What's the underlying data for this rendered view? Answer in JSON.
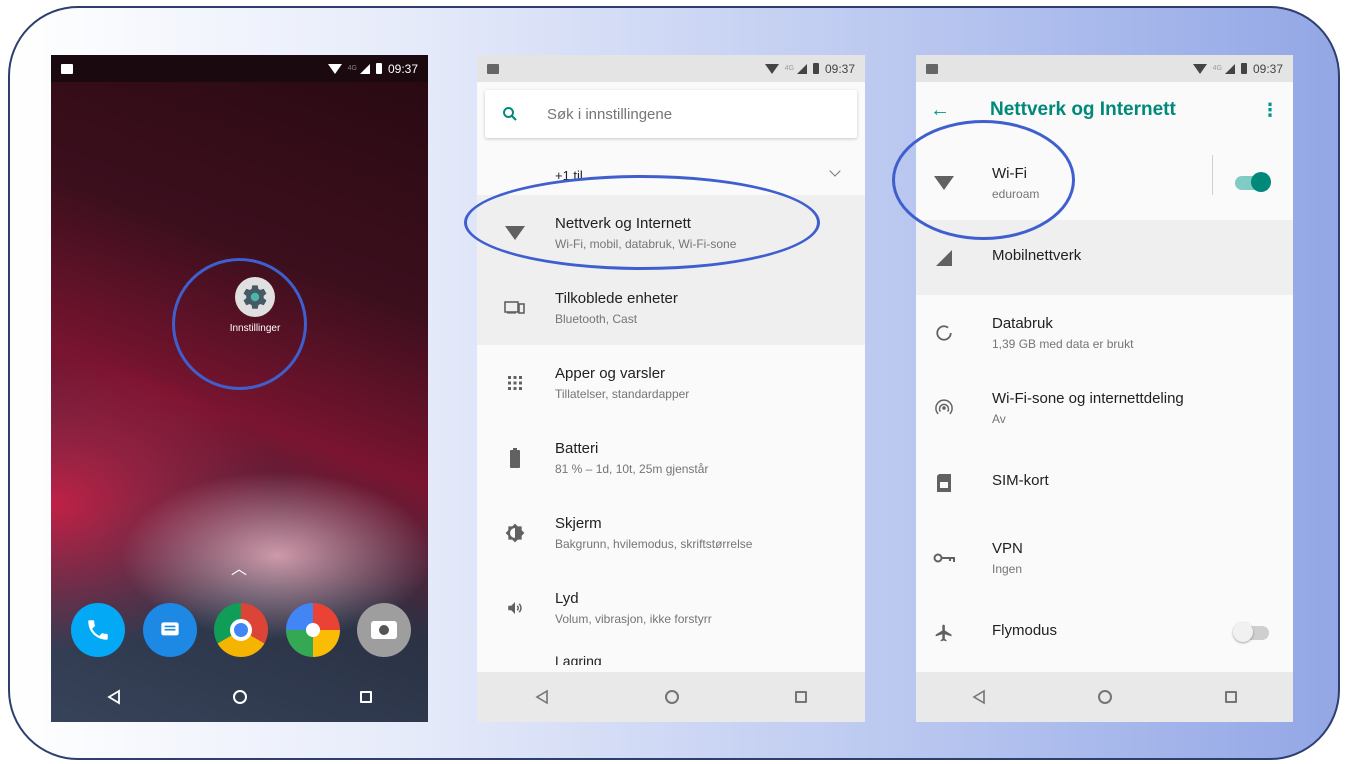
{
  "phone1": {
    "status": {
      "time": "09:37",
      "network": "4G"
    },
    "app_label": "Innstillinger",
    "dock": [
      "phone-icon",
      "messages-icon",
      "chrome-icon",
      "photos-icon",
      "camera-icon"
    ]
  },
  "phone2": {
    "status": {
      "time": "09:37",
      "network": "4G"
    },
    "search_placeholder": "Søk i innstillingene",
    "more_label": "+1 til",
    "items": [
      {
        "title": "Nettverk og Internett",
        "subtitle": "Wi-Fi, mobil, databruk, Wi-Fi-sone",
        "icon": "wifi-icon"
      },
      {
        "title": "Tilkoblede enheter",
        "subtitle": "Bluetooth, Cast",
        "icon": "devices-icon"
      },
      {
        "title": "Apper og varsler",
        "subtitle": "Tillatelser, standardapper",
        "icon": "apps-icon"
      },
      {
        "title": "Batteri",
        "subtitle": "81 % – 1d, 10t, 25m gjenstår",
        "icon": "battery-icon"
      },
      {
        "title": "Skjerm",
        "subtitle": "Bakgrunn, hvilemodus, skriftstørrelse",
        "icon": "brightness-icon"
      },
      {
        "title": "Lyd",
        "subtitle": "Volum, vibrasjon, ikke forstyrr",
        "icon": "volume-icon"
      }
    ],
    "partial_item": "Lagring"
  },
  "phone3": {
    "status": {
      "time": "09:37",
      "network": "4G"
    },
    "title": "Nettverk og Internett",
    "items": [
      {
        "title": "Wi-Fi",
        "subtitle": "eduroam",
        "icon": "wifi-icon",
        "toggle": true
      },
      {
        "title": "Mobilnettverk",
        "subtitle": "",
        "icon": "cellular-signal-icon"
      },
      {
        "title": "Databruk",
        "subtitle": "1,39 GB med data er brukt",
        "icon": "data-usage-icon"
      },
      {
        "title": "Wi-Fi-sone og internettdeling",
        "subtitle": "Av",
        "icon": "hotspot-icon"
      },
      {
        "title": "SIM-kort",
        "subtitle": "",
        "icon": "sim-card-icon"
      },
      {
        "title": "VPN",
        "subtitle": "Ingen",
        "icon": "vpn-key-icon"
      },
      {
        "title": "Flymodus",
        "subtitle": "",
        "icon": "airplane-icon",
        "toggle": false
      }
    ]
  },
  "colors": {
    "accent": "#00897b",
    "annotation": "#3f5fcf"
  }
}
